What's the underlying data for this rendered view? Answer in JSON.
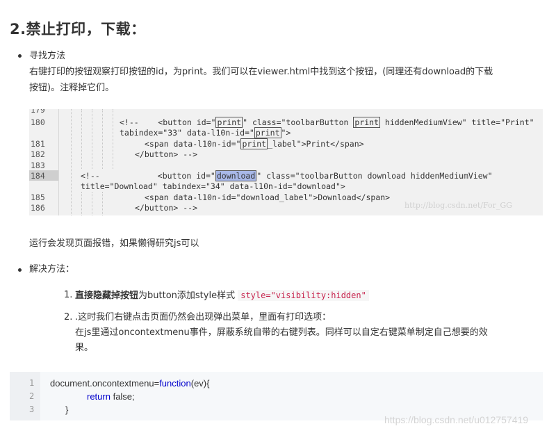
{
  "heading": "2.禁止打印，下载：",
  "section1": {
    "title": "寻找方法",
    "para_line1": "右键打印的按钮观察打印按钮的id，为print。我们可以在viewer.html中找到这个按钮，(同理还有download的下载",
    "para_line2": "按钮)。注释掉它们。"
  },
  "code_screenshot": {
    "lines": [
      {
        "num": "179",
        "parts": [
          ""
        ]
      },
      {
        "num": "180",
        "parts": [
          "<!--    <button id=\"",
          "print",
          "\" class=\"toolbarButton ",
          "print",
          " hiddenMediumView\" title=\"Print\""
        ]
      },
      {
        "num": "",
        "parts": [
          "tabindex=\"33\" data-l10n-id=\"",
          "print",
          "\">"
        ]
      },
      {
        "num": "181",
        "parts": [
          "<span data-l10n-id=\"",
          "print",
          "_label\">Print</span>"
        ]
      },
      {
        "num": "182",
        "parts": [
          "</button> -->"
        ]
      },
      {
        "num": "183",
        "parts": [
          ""
        ]
      },
      {
        "num": "184",
        "parts": [
          "<!--            <button id=\"",
          "download",
          "\" class=\"toolbarButton download hiddenMediumView\""
        ]
      },
      {
        "num": "",
        "parts": [
          "title=\"Download\" tabindex=\"34\" data-l10n-id=\"download\">"
        ]
      },
      {
        "num": "185",
        "parts": [
          "<span data-l10n-id=\"download_label\">Download</span>"
        ]
      },
      {
        "num": "186",
        "parts": [
          "</button> -->"
        ]
      }
    ],
    "watermark": "http://blog.csdn.net/For_GG"
  },
  "error_note": "运行会发现页面报错，如果懒得研究js可以",
  "section2": {
    "title": "解决方法：",
    "items": [
      {
        "num": "1.",
        "bold": "直接隐藏掉按钮",
        "text": "为button添加style样式",
        "code": "style=\"visibility:hidden\""
      },
      {
        "num": "2.",
        "line1": ".这时我们右键点击页面仍然会出现弹出菜单，里面有打印选项：",
        "line2": "在js里通过oncontextmenu事件，屏蔽系统自带的右键列表。同样可以自定右键菜单制定自己想要的效",
        "line3": "果。"
      }
    ]
  },
  "snippet": {
    "line_numbers": [
      "1",
      "2",
      "3"
    ],
    "line1_a": "document.oncontextmenu=",
    "line1_kw": "function",
    "line1_b": "(ev){",
    "line2_kw": "return",
    "line2_b": " false;",
    "line3": "}"
  },
  "watermark": "https://blog.csdn.net/u012757419"
}
